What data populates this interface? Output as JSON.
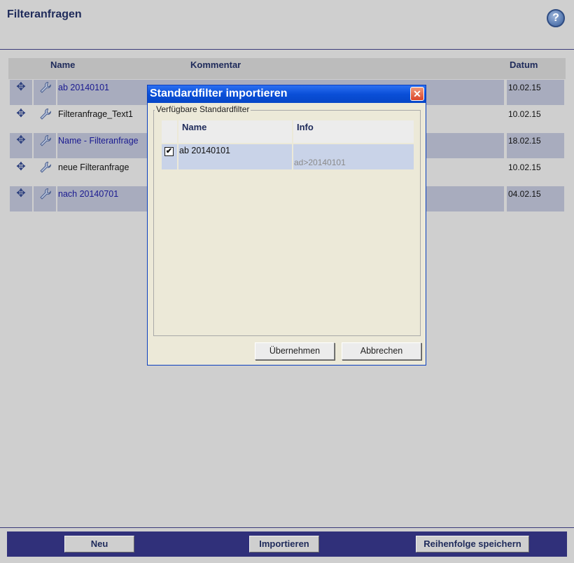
{
  "page": {
    "title": "Filteranfragen",
    "help_glyph": "?"
  },
  "table": {
    "headers": {
      "name": "Name",
      "kommentar": "Kommentar",
      "datum": "Datum"
    },
    "rows": [
      {
        "name": "ab 20140101",
        "date": "10.02.15",
        "style": "link",
        "shaded": true
      },
      {
        "name": "Filteranfrage_Text1",
        "date": "10.02.15",
        "style": "plain",
        "shaded": false
      },
      {
        "name": "Name - Filteranfrage",
        "date": "18.02.15",
        "style": "link",
        "shaded": true
      },
      {
        "name": "neue Filteranfrage",
        "date": "10.02.15",
        "style": "plain",
        "shaded": false
      },
      {
        "name": "nach 20140701",
        "date": "04.02.15",
        "style": "link",
        "shaded": true
      }
    ]
  },
  "dialog": {
    "title": "Standardfilter importieren",
    "close_glyph": "✕",
    "fieldset_legend": "Verfügbare Standardfilter",
    "columns": {
      "name": "Name",
      "info": "Info"
    },
    "rows": [
      {
        "checked": true,
        "check_glyph": "✔",
        "name": "ab 20140101",
        "info": "ad>20140101"
      }
    ],
    "buttons": {
      "apply": "Übernehmen",
      "cancel": "Abbrechen"
    }
  },
  "footer": {
    "new_label": "Neu",
    "import_label": "Importieren",
    "save_order_label": "Reihenfolge speichern"
  },
  "colors": {
    "title_text": "#1e2a5a",
    "dialog_title_bar": "#0a4fd8",
    "footer_bar": "#30307a",
    "row_shade": "#a8acbe",
    "link_text": "#1a1a90"
  },
  "icons": {
    "move": "move-icon",
    "edit": "wrench-icon",
    "help": "help-icon",
    "close": "close-icon"
  }
}
